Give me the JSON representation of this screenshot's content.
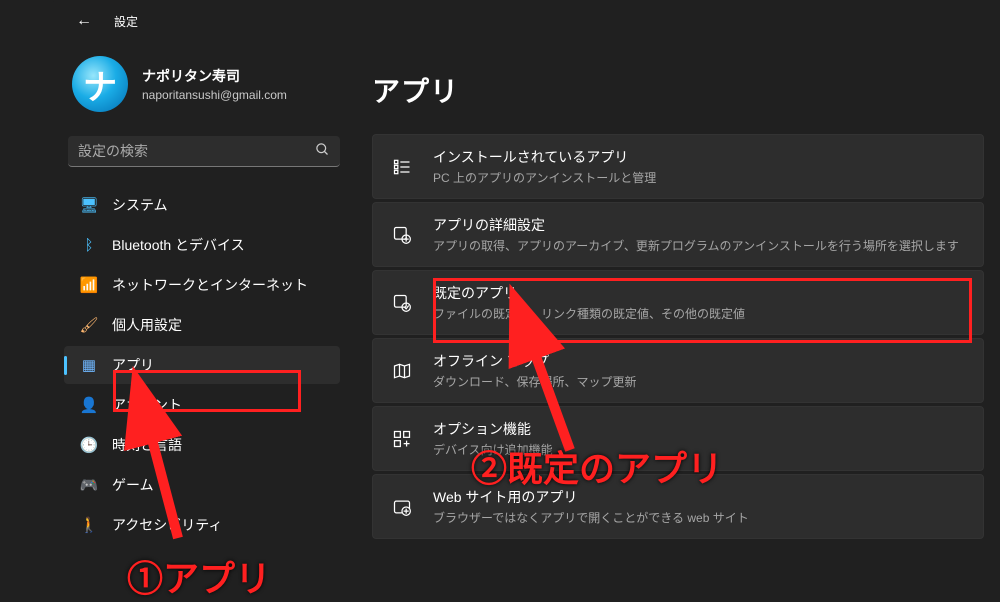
{
  "window": {
    "title": "設定"
  },
  "profile": {
    "name": "ナポリタン寿司",
    "email": "naporitansushi@gmail.com",
    "avatar_char": "ナ"
  },
  "search": {
    "placeholder": "設定の検索"
  },
  "sidebar": {
    "items": [
      {
        "icon": "display-icon",
        "icon_glyph": "🖥",
        "label": "システム",
        "selected": false,
        "icon_class": "c-blue"
      },
      {
        "icon": "bluetooth-icon",
        "icon_glyph": "ᛒ",
        "label": "Bluetooth とデバイス",
        "selected": false,
        "icon_class": "c-blue"
      },
      {
        "icon": "wifi-icon",
        "icon_glyph": "📶",
        "label": "ネットワークとインターネット",
        "selected": false,
        "icon_class": "c-wifi"
      },
      {
        "icon": "brush-icon",
        "icon_glyph": "🖌",
        "label": "個人用設定",
        "selected": false,
        "icon_class": "c-brush"
      },
      {
        "icon": "apps-icon",
        "icon_glyph": "▦",
        "label": "アプリ",
        "selected": true,
        "icon_class": "c-apps"
      },
      {
        "icon": "account-icon",
        "icon_glyph": "👤",
        "label": "アカウント",
        "selected": false,
        "icon_class": "c-acct"
      },
      {
        "icon": "clock-icon",
        "icon_glyph": "🕒",
        "label": "時刻と言語",
        "selected": false,
        "icon_class": "c-time"
      },
      {
        "icon": "gamepad-icon",
        "icon_glyph": "🎮",
        "label": "ゲーム",
        "selected": false,
        "icon_class": "c-game"
      },
      {
        "icon": "accessibility-icon",
        "icon_glyph": "🚶",
        "label": "アクセシビリティ",
        "selected": false,
        "icon_class": "c-accx"
      }
    ]
  },
  "main": {
    "title": "アプリ",
    "cards": [
      {
        "icon": "list-icon",
        "title": "インストールされているアプリ",
        "subtitle": "PC 上のアプリのアンインストールと管理"
      },
      {
        "icon": "gear-app-icon",
        "title": "アプリの詳細設定",
        "subtitle": "アプリの取得、アプリのアーカイブ、更新プログラムのアンインストールを行う場所を選択します"
      },
      {
        "icon": "default-app-icon",
        "title": "既定のアプリ",
        "subtitle": "ファイルの既定値、リンク種類の既定値、その他の既定値"
      },
      {
        "icon": "map-icon",
        "title": "オフライン マップ",
        "subtitle": "ダウンロード、保存場所、マップ更新"
      },
      {
        "icon": "feature-icon",
        "title": "オプション機能",
        "subtitle": "デバイス向け追加機能"
      },
      {
        "icon": "web-app-icon",
        "title": "Web サイト用のアプリ",
        "subtitle": "ブラウザーではなくアプリで開くことができる web サイト"
      }
    ]
  },
  "annotations": {
    "a1": "①アプリ",
    "a2": "②既定のアプリ"
  }
}
